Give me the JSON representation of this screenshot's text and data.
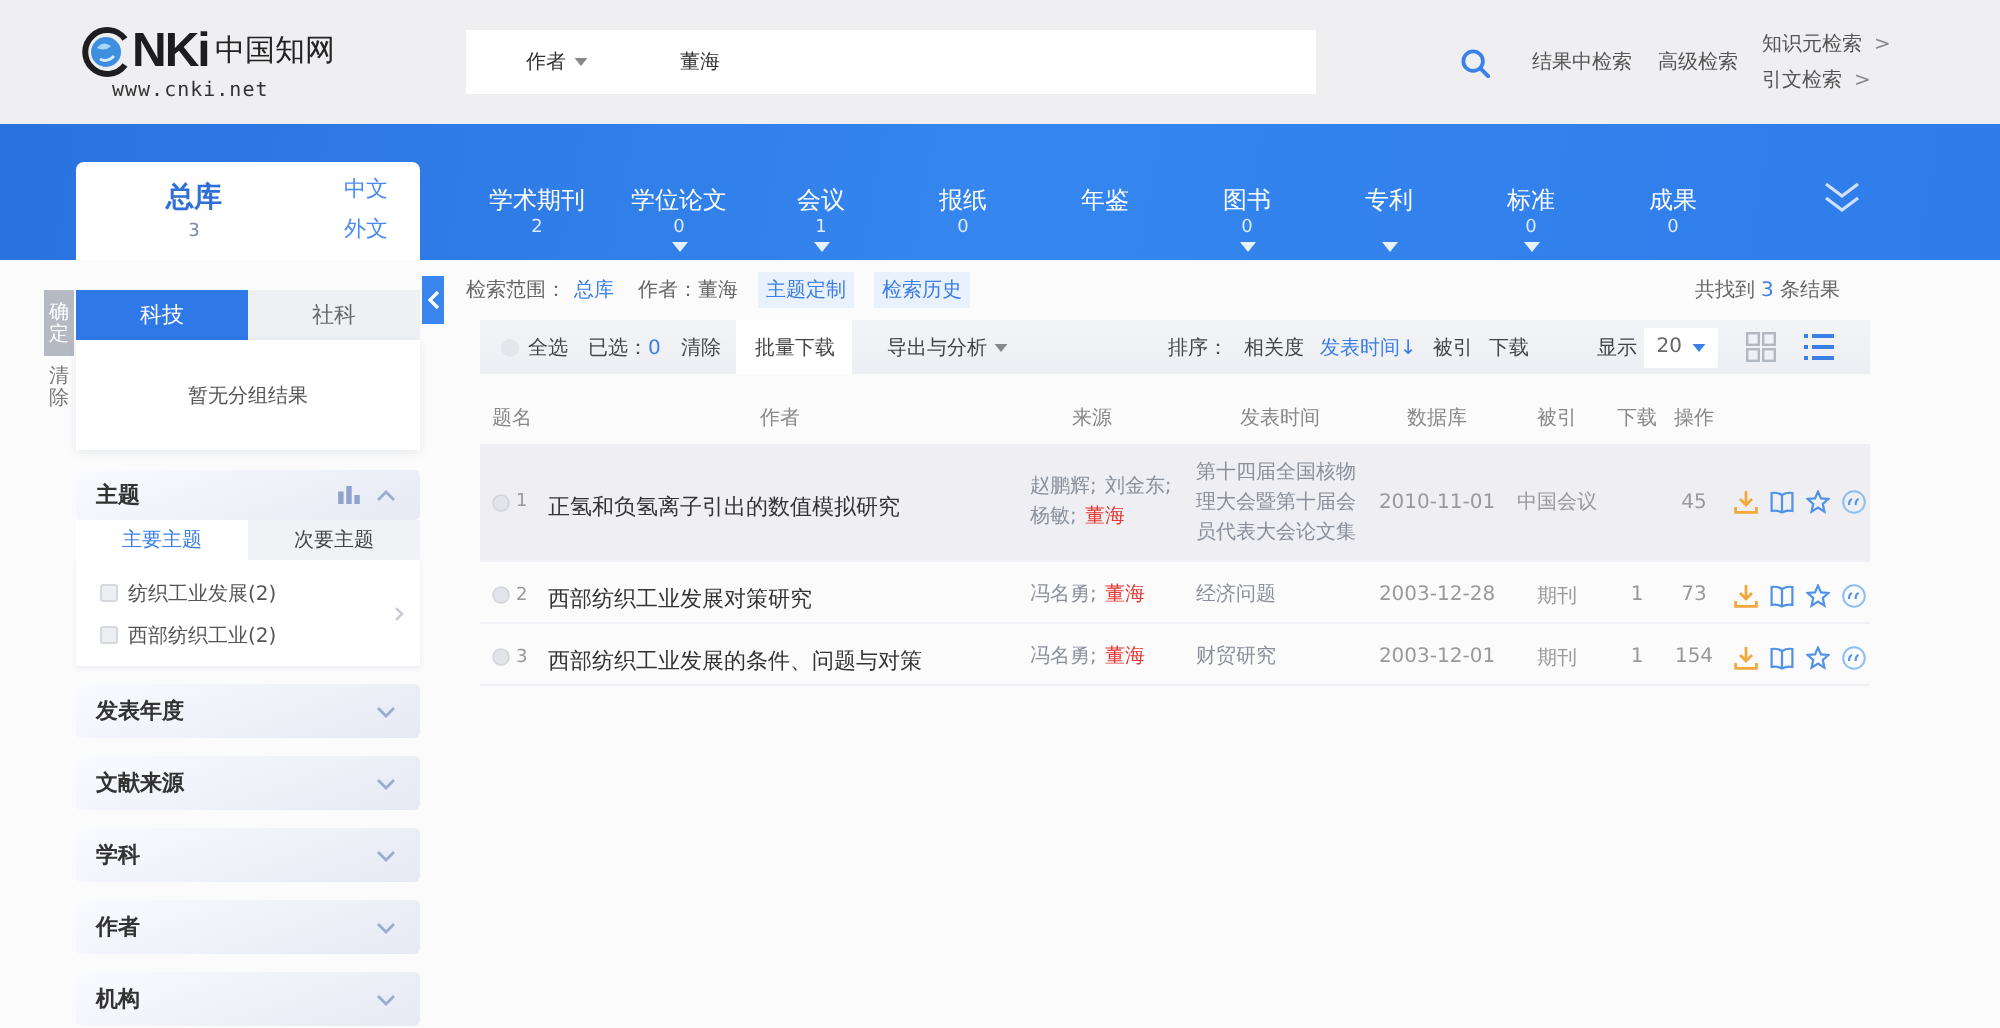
{
  "header": {
    "logo": {
      "wordmark": "NKi",
      "name": "中国知网",
      "url": "www.cnki.net"
    },
    "search": {
      "field": "作者",
      "value": "董海"
    },
    "links": [
      "结果中检索",
      "高级检索"
    ],
    "side_links": [
      {
        "label": "知识元检索",
        "arrow": ">"
      },
      {
        "label": "引文检索",
        "arrow": ">"
      }
    ]
  },
  "library": {
    "total": {
      "label": "总库",
      "count": "3",
      "selected": true
    },
    "languages": [
      "中文",
      "外文"
    ],
    "categories": [
      {
        "label": "学术期刊",
        "count": "2",
        "dropdown": false,
        "selected": false
      },
      {
        "label": "学位论文",
        "count": "0",
        "dropdown": true,
        "selected": false
      },
      {
        "label": "会议",
        "count": "1",
        "dropdown": true,
        "selected": false
      },
      {
        "label": "报纸",
        "count": "0",
        "dropdown": false,
        "selected": false
      },
      {
        "label": "年鉴",
        "dropdown": false,
        "selected": false
      },
      {
        "label": "图书",
        "count": "0",
        "dropdown": true,
        "selected": false
      },
      {
        "label": "专利",
        "dropdown": true,
        "selected": false
      },
      {
        "label": "标准",
        "count": "0",
        "dropdown": true,
        "selected": false
      },
      {
        "label": "成果",
        "count": "0",
        "dropdown": false,
        "selected": false
      }
    ]
  },
  "filter_buttons": [
    {
      "label": "确定",
      "kind": "primary"
    },
    {
      "label": "清除",
      "kind": "plain"
    }
  ],
  "group_tabs": [
    {
      "label": "科技",
      "selected": true
    },
    {
      "label": "社科",
      "selected": false
    }
  ],
  "group_message": "暂无分组结果",
  "facets": [
    {
      "title": "主题",
      "expanded": true,
      "subtabs": [
        {
          "label": "主要主题",
          "selected": true
        },
        {
          "label": "次要主题",
          "selected": false
        }
      ],
      "items": [
        {
          "label": "纺织工业发展(2)",
          "checked": false
        },
        {
          "label": "西部纺织工业(2)",
          "checked": false
        }
      ]
    },
    {
      "title": "发表年度",
      "expanded": false
    },
    {
      "title": "文献来源",
      "expanded": false
    },
    {
      "title": "学科",
      "expanded": false
    },
    {
      "title": "作者",
      "expanded": false
    },
    {
      "title": "机构",
      "expanded": false
    }
  ],
  "scope": {
    "label": "检索范围：",
    "value": "总库",
    "query": "作者：董海",
    "links": [
      "主题定制",
      "检索历史"
    ],
    "summary": {
      "prefix": "共找到",
      "count": "3",
      "suffix": "条结果"
    }
  },
  "toolbar": {
    "select_all": {
      "label": "全选",
      "checked": false
    },
    "selected": {
      "label": "已选：",
      "count": "0"
    },
    "clear": "清除",
    "actions": [
      {
        "label": "批量下载",
        "dropdown": false,
        "highlighted": true
      },
      {
        "label": "导出与分析",
        "dropdown": true,
        "highlighted": false
      }
    ],
    "sort_label": "排序：",
    "sort_options": [
      {
        "label": "相关度",
        "selected": false
      },
      {
        "label": "发表时间",
        "arrow": "↓",
        "selected": true
      },
      {
        "label": "被引",
        "selected": false
      },
      {
        "label": "下载",
        "selected": false
      }
    ],
    "page_size_label": "显示",
    "page_size": "20",
    "views": [
      {
        "kind": "grid",
        "selected": false
      },
      {
        "kind": "list",
        "selected": true
      }
    ]
  },
  "table": {
    "columns": [
      "题名",
      "作者",
      "来源",
      "发表时间",
      "数据库",
      "被引",
      "下载",
      "操作"
    ],
    "rows": [
      {
        "number": "1",
        "checked": false,
        "highlighted": true,
        "title": "正氢和负氢离子引出的数值模拟研究",
        "authors": [
          {
            "text": "赵鹏辉;",
            "match": false
          },
          {
            "text": "刘金东;",
            "match": false
          },
          {
            "text": "杨敏;",
            "match": false
          },
          {
            "text": "董海",
            "match": true
          }
        ],
        "source": "第十四届全国核物理大会暨第十届会员代表大会论文集",
        "date": "2010-11-01",
        "database": "中国会议",
        "downloads": "45"
      },
      {
        "number": "2",
        "checked": false,
        "highlighted": false,
        "title": "西部纺织工业发展对策研究",
        "authors": [
          {
            "text": "冯名勇;",
            "match": false
          },
          {
            "text": "董海",
            "match": true
          }
        ],
        "source": "经济问题",
        "date": "2003-12-28",
        "database": "期刊",
        "cited": "1",
        "downloads": "73"
      },
      {
        "number": "3",
        "checked": false,
        "highlighted": false,
        "title": "西部纺织工业发展的条件、问题与对策",
        "authors": [
          {
            "text": "冯名勇;",
            "match": false
          },
          {
            "text": "董海",
            "match": true
          }
        ],
        "source": "财贸研究",
        "date": "2003-12-01",
        "database": "期刊",
        "cited": "1",
        "downloads": "154"
      }
    ]
  }
}
